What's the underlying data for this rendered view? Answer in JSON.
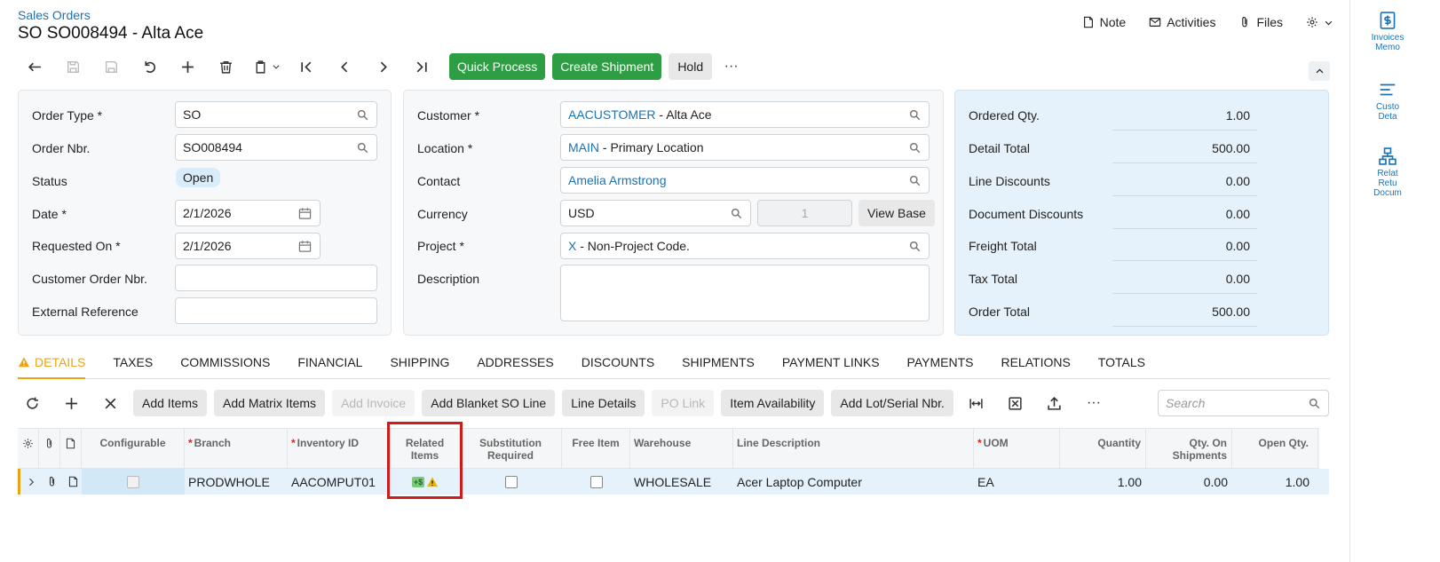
{
  "header": {
    "breadcrumb": "Sales Orders",
    "title": "SO SO008494 - Alta Ace",
    "actions": {
      "note": "Note",
      "activities": "Activities",
      "files": "Files"
    }
  },
  "toolbar": {
    "quick_process": "Quick Process",
    "create_shipment": "Create Shipment",
    "hold": "Hold",
    "more": "···"
  },
  "order": {
    "order_type_label": "Order Type *",
    "order_type": "SO",
    "order_nbr_label": "Order Nbr.",
    "order_nbr": "SO008494",
    "status_label": "Status",
    "status": "Open",
    "date_label": "Date *",
    "date": "2/1/2026",
    "requested_on_label": "Requested On *",
    "requested_on": "2/1/2026",
    "customer_order_nbr_label": "Customer Order Nbr.",
    "customer_order_nbr": "",
    "external_reference_label": "External Reference",
    "external_reference": ""
  },
  "customer": {
    "customer_label": "Customer *",
    "customer_id": "AACUSTOMER",
    "customer_name": " - Alta Ace",
    "location_label": "Location *",
    "location_id": "MAIN",
    "location_name": " - Primary Location",
    "contact_label": "Contact",
    "contact": "Amelia Armstrong",
    "currency_label": "Currency",
    "currency": "USD",
    "currency_rate": "1",
    "view_base": "View Base",
    "project_label": "Project *",
    "project_id": "X",
    "project_name": " - Non-Project Code.",
    "description_label": "Description",
    "description": ""
  },
  "summary": [
    {
      "label": "Ordered Qty.",
      "value": "1.00"
    },
    {
      "label": "Detail Total",
      "value": "500.00"
    },
    {
      "label": "Line Discounts",
      "value": "0.00"
    },
    {
      "label": "Document Discounts",
      "value": "0.00"
    },
    {
      "label": "Freight Total",
      "value": "0.00"
    },
    {
      "label": "Tax Total",
      "value": "0.00"
    },
    {
      "label": "Order Total",
      "value": "500.00"
    }
  ],
  "tabs": [
    "DETAILS",
    "TAXES",
    "COMMISSIONS",
    "FINANCIAL",
    "SHIPPING",
    "ADDRESSES",
    "DISCOUNTS",
    "SHIPMENTS",
    "PAYMENT LINKS",
    "PAYMENTS",
    "RELATIONS",
    "TOTALS"
  ],
  "grid_toolbar": {
    "add_items": "Add Items",
    "add_matrix_items": "Add Matrix Items",
    "add_invoice": "Add Invoice",
    "add_blanket_so_line": "Add Blanket SO Line",
    "line_details": "Line Details",
    "po_link": "PO Link",
    "item_availability": "Item Availability",
    "add_lot_serial": "Add Lot/Serial Nbr.",
    "more": "···",
    "search_placeholder": "Search"
  },
  "grid": {
    "columns": {
      "configurable": "Configurable",
      "branch": "Branch",
      "inventory_id": "Inventory ID",
      "related_items_1": "Related",
      "related_items_2": "Items",
      "substitution_1": "Substitution",
      "substitution_2": "Required",
      "free_item": "Free Item",
      "warehouse": "Warehouse",
      "line_description": "Line Description",
      "uom": "UOM",
      "quantity": "Quantity",
      "qty_on_shipments_1": "Qty. On",
      "qty_on_shipments_2": "Shipments",
      "open_qty": "Open Qty."
    },
    "row": {
      "branch": "PRODWHOLE",
      "inventory_id": "AACOMPUT01",
      "related_badge": "+$",
      "warehouse": "WHOLESALE",
      "line_description": "Acer Laptop Computer",
      "uom": "EA",
      "quantity": "1.00",
      "qty_on_shipments": "0.00",
      "open_qty": "1.00"
    }
  },
  "rail": [
    {
      "line1": "Invoices",
      "line2": "Memo"
    },
    {
      "line1": "Custo",
      "line2": "Deta"
    },
    {
      "line1": "Relat",
      "line2": "Retu",
      "line3": "Docum"
    }
  ],
  "colors": {
    "accent": "#2e9e45",
    "link": "#1a73b5",
    "active_tab": "#e8a317",
    "highlight": "#d01b1b"
  }
}
